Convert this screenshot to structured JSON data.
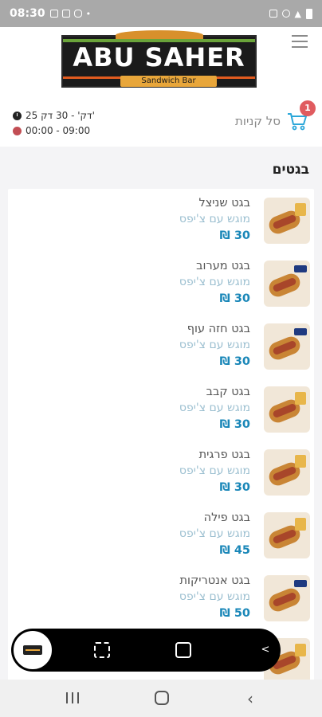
{
  "status_bar": {
    "time": "08:30",
    "left_icons": [
      "image-icon",
      "chat-icon",
      "instagram-icon",
      "dot"
    ],
    "right_icons": [
      "alarm-icon",
      "wifi-icon",
      "signal-icon",
      "battery-icon"
    ]
  },
  "header": {
    "logo": {
      "name": "ABU SAHER",
      "subtitle": "Sandwich Bar"
    },
    "cart": {
      "label": "סל קניות",
      "count": "1"
    },
    "delivery_time": "25 דק' - 30 דק'",
    "opening_hours": "00:00 - 09:00"
  },
  "category": {
    "title": "בגטים"
  },
  "items": [
    {
      "name": "בגט שניצל",
      "desc": "מוגש עם צ'יפס",
      "price": "30 ₪"
    },
    {
      "name": "בגט מערוב",
      "desc": "מוגש עם צ'יפס",
      "price": "30 ₪"
    },
    {
      "name": "בגט חזה עוף",
      "desc": "מוגש עם צ'יפס",
      "price": "30 ₪"
    },
    {
      "name": "בגט קבב",
      "desc": "מוגש עם צ'יפס",
      "price": "30 ₪"
    },
    {
      "name": "בגט פרגית",
      "desc": "מוגש עם צ'יפס",
      "price": "30 ₪"
    },
    {
      "name": "בגט פילה",
      "desc": "מוגש עם צ'יפס",
      "price": "45 ₪"
    },
    {
      "name": "בגט אנטריקות",
      "desc": "מוגש עם צ'יפס",
      "price": "50 ₪"
    },
    {
      "name": "",
      "desc": "",
      "price": ""
    }
  ],
  "colors": {
    "price": "#1a87b8",
    "desc": "#9bbfd0",
    "badge": "#e05b5f",
    "cart": "#2ba7d9",
    "logo_orange": "#e8a63a",
    "logo_green": "#6aa33a"
  }
}
